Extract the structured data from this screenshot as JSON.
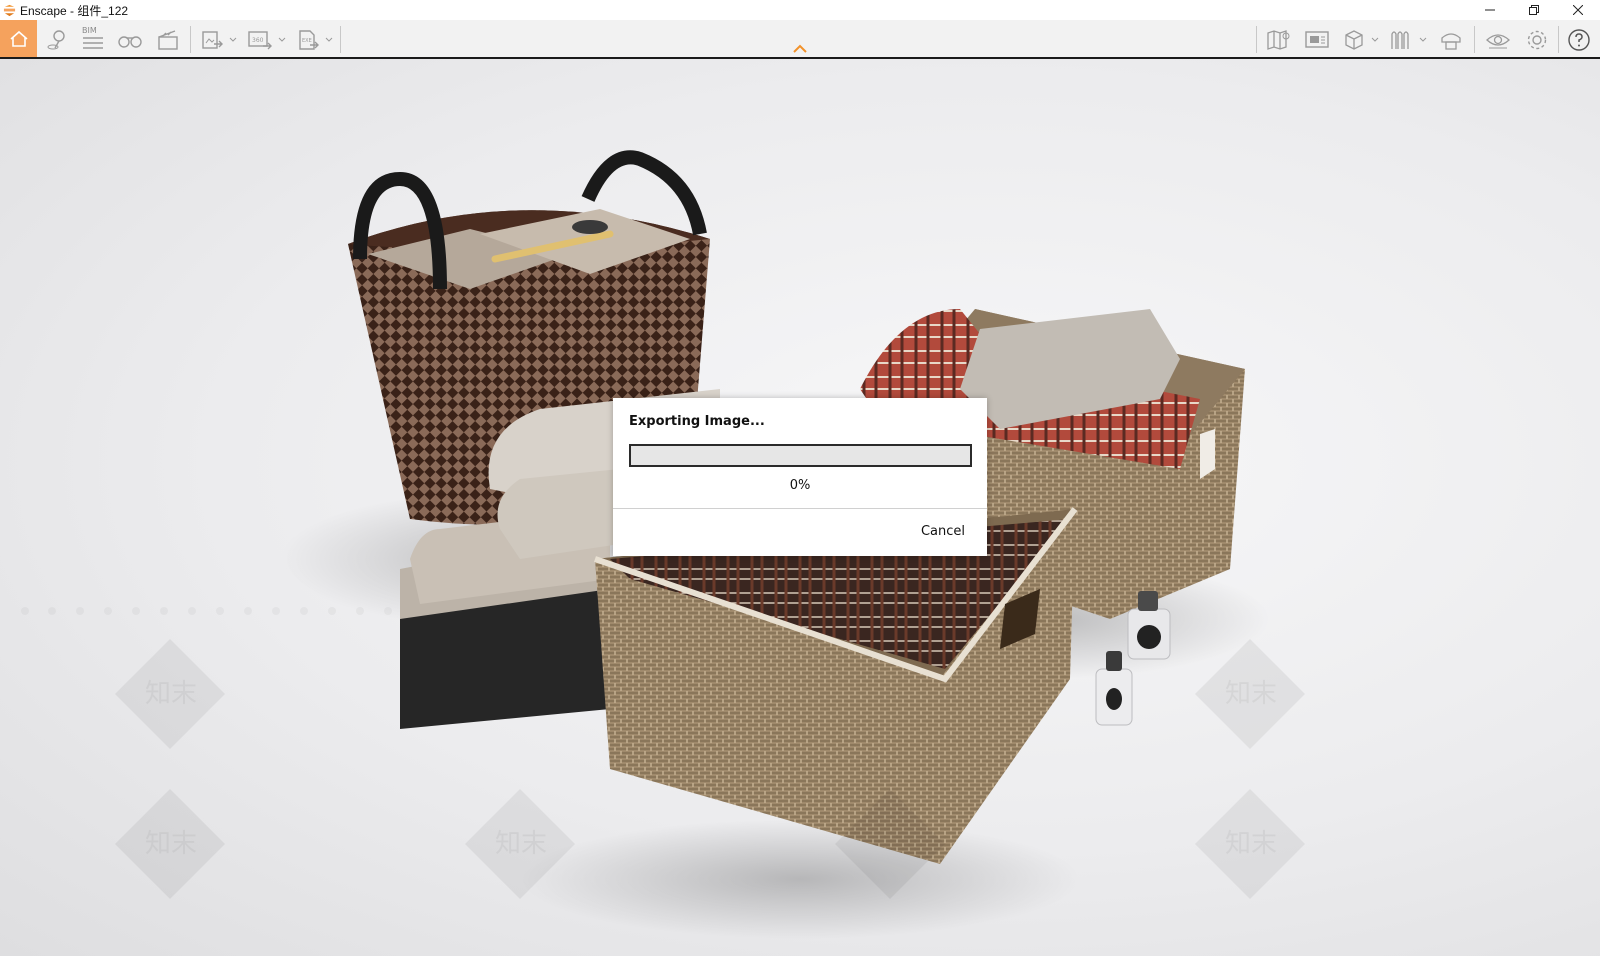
{
  "window": {
    "title": "Enscape - 组件_122"
  },
  "toolbar": {
    "left_icons": [
      "home-icon",
      "location-pin-icon",
      "bim-icon",
      "binoculars-icon",
      "clapperboard-icon",
      "export-image-icon",
      "export-360-icon",
      "export-exe-icon"
    ],
    "bim_label": "BIM",
    "right_icons": [
      "map-icon",
      "screen-icon",
      "cube-icon",
      "asset-library-icon",
      "capture-icon",
      "eye-icon",
      "gear-icon",
      "help-icon"
    ],
    "accent_color": "#f5a25d"
  },
  "dialog": {
    "title": "Exporting Image...",
    "progress_percent": 0,
    "progress_label": "0%",
    "cancel_label": "Cancel"
  },
  "watermark": {
    "text": "知末"
  }
}
